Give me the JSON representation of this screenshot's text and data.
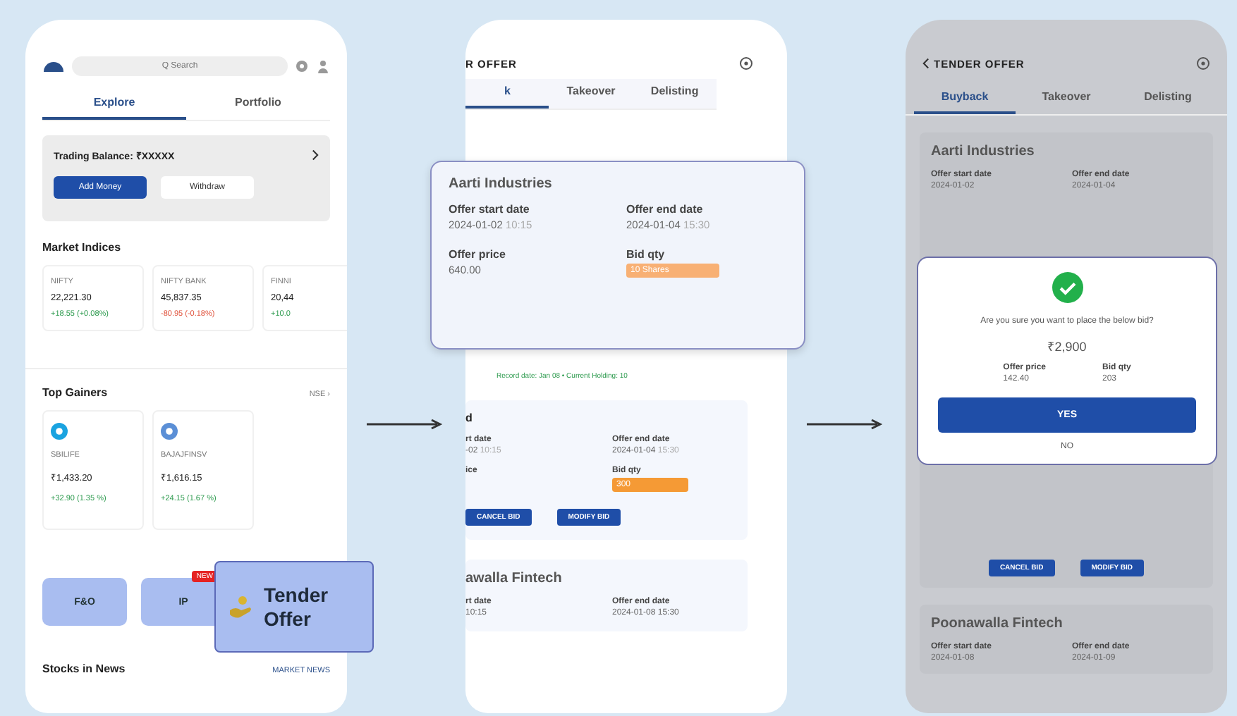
{
  "explore_screen": {
    "search": {
      "placeholder": "Q Search"
    },
    "tabs": [
      {
        "label": "Explore",
        "selected": true
      },
      {
        "label": "Portfolio",
        "selected": false
      }
    ],
    "balance": {
      "label": "Trading Balance: ₹XXXXX",
      "add_button": "Add Money",
      "withdraw_button": "Withdraw"
    },
    "market_indices": {
      "title": "Market Indices",
      "items": [
        {
          "name": "NIFTY",
          "value": "22,221.30",
          "change": "+18.55 (+0.08%)",
          "color": "#2e9b4f"
        },
        {
          "name": "NIFTY BANK",
          "value": "45,837.35",
          "change": "-80.95 (-0.18%)",
          "color": "#e0533d"
        },
        {
          "name": "FINNI",
          "value": "20,44",
          "change": "+10.0",
          "color": "#2e9b4f"
        }
      ]
    },
    "top_gainers": {
      "title": "Top Gainers",
      "exchange": "NSE ›",
      "items": [
        {
          "name": "SBILIFE",
          "price": "₹1,433.20",
          "change": "+32.90 (1.35 %)"
        },
        {
          "name": "BAJAJFINSV",
          "price": "₹1,616.15",
          "change": "+24.15 (1.67 %)"
        }
      ]
    },
    "shortcuts": [
      {
        "label": "F&O"
      },
      {
        "label": "IP",
        "badge": "NEW"
      }
    ],
    "stocks_in_news": {
      "title": "Stocks in News",
      "link": "MARKET NEWS"
    },
    "callout": {
      "label": "Tender Offer"
    }
  },
  "list_screen": {
    "title": "R OFFER",
    "tabs": [
      {
        "label": "k",
        "selected": true
      },
      {
        "label": "Takeover",
        "selected": false
      },
      {
        "label": "Delisting",
        "selected": false
      }
    ],
    "highlight_card": {
      "company": "Aarti Industries",
      "start_label": "Offer start date",
      "start_date": "2024-01-02",
      "start_time": "10:15",
      "end_label": "Offer end date",
      "end_date": "2024-01-04",
      "end_time": "15:30",
      "price_label": "Offer price",
      "price": "640.00",
      "qty_label": "Bid qty",
      "qty": "10 Shares"
    },
    "note": "Record date: Jan 08 • Current Holding: 10",
    "bid_card": {
      "company": "d",
      "start_label": "rt date",
      "start_date": "-02",
      "start_time": "10:15",
      "end_label": "Offer end date",
      "end_date": "2024-01-04",
      "end_time": "15:30",
      "price_label": "ice",
      "qty_label": "Bid qty",
      "qty": "300",
      "cancel_button": "CANCEL BID",
      "modify_button": "MODIFY BID"
    },
    "next_card": {
      "company": "awalla Fintech",
      "start_label": "rt date",
      "start_date": "10:15",
      "end_label": "Offer end date",
      "end_date": "2024-01-08 15:30"
    }
  },
  "confirm_screen": {
    "title": "TENDER OFFER",
    "tabs": [
      {
        "label": "Buyback",
        "selected": true
      },
      {
        "label": "Takeover",
        "selected": false
      },
      {
        "label": "Delisting",
        "selected": false
      }
    ],
    "card": {
      "company": "Aarti Industries",
      "start_label": "Offer start date",
      "start_date": "2024-01-02",
      "end_label": "Offer end date",
      "end_date": "2024-01-04",
      "cancel_button": "CANCEL BID",
      "modify_button": "MODIFY BID"
    },
    "next_card": {
      "company": "Poonawalla Fintech",
      "start_label": "Offer start date",
      "start_date": "2024-01-08",
      "end_label": "Offer end date",
      "end_date": "2024-01-09"
    },
    "dialog": {
      "question": "Are you sure you want to place the below bid?",
      "amount": "₹2,900",
      "price_label": "Offer price",
      "price": "142.40",
      "qty_label": "Bid qty",
      "qty": "203",
      "yes_button": "YES",
      "no_button": "NO"
    }
  }
}
